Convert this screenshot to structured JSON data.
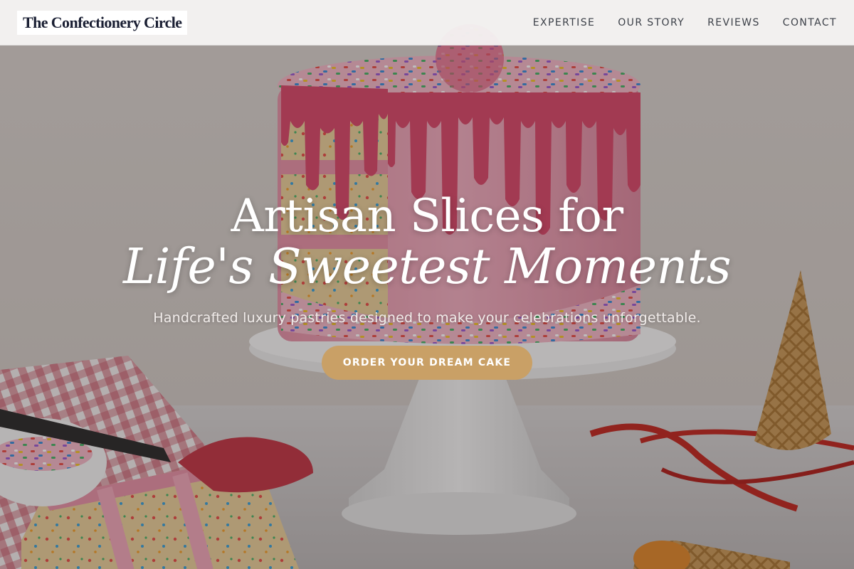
{
  "brand": {
    "name": "The Confectionery Circle"
  },
  "nav": {
    "items": [
      {
        "label": "EXPERTISE"
      },
      {
        "label": "OUR STORY"
      },
      {
        "label": "REVIEWS"
      },
      {
        "label": "CONTACT"
      }
    ]
  },
  "hero": {
    "headline_line1": "Artisan Slices for",
    "headline_line2": "Life's Sweetest Moments",
    "subtitle": "Handcrafted luxury pastries designed to make your celebrations unforgettable.",
    "cta_label": "ORDER YOUR DREAM CAKE",
    "background": "drip-cake-photo"
  },
  "colors": {
    "accent": "#c9a066",
    "brand_text": "#1a1f33",
    "nav_text": "#3c4048",
    "frosting_pink": "#d65a78"
  }
}
